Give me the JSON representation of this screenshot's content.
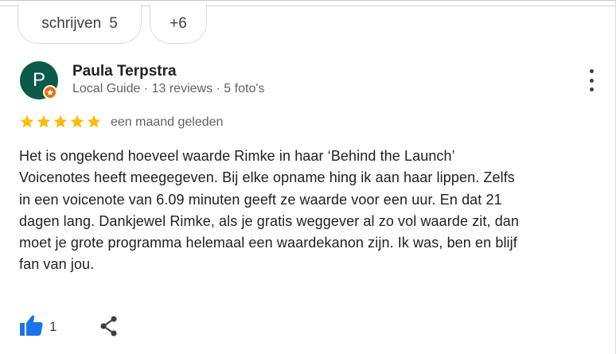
{
  "chips": [
    {
      "label": "schrijven",
      "count": "5"
    },
    {
      "label": "+6"
    }
  ],
  "review": {
    "avatar_letter": "P",
    "author": "Paula Terpstra",
    "meta": "Local Guide · 13 reviews · 5 foto's",
    "rating": 5,
    "date": "een maand geleden",
    "text_lines": [
      "Het is ongekend hoeveel waarde Rimke in haar ‘Behind the Launch’",
      "Voicenotes heeft meegegeven. Bij elke opname hing ik aan haar lippen. Zelfs",
      "in een voicenote van 6.09 minuten geeft ze waarde voor een uur. En dat 21",
      "dagen lang. Dankjewel Rimke, als je gratis weggever al zo vol waarde zit, dan",
      "moet je grote programma helemaal een waardekanon zijn. Ik was, ben en blijf",
      "fan van jou."
    ],
    "likes": "1"
  },
  "icons": {
    "badge": "local-guide-star-icon",
    "menu": "more-vert-icon",
    "star": "star-icon",
    "like": "thumb-up-icon",
    "share": "share-icon"
  },
  "colors": {
    "avatar": "#0b5a4a",
    "badge": "#e8710a",
    "star": "#fbbc04",
    "like": "#1a73e8"
  }
}
